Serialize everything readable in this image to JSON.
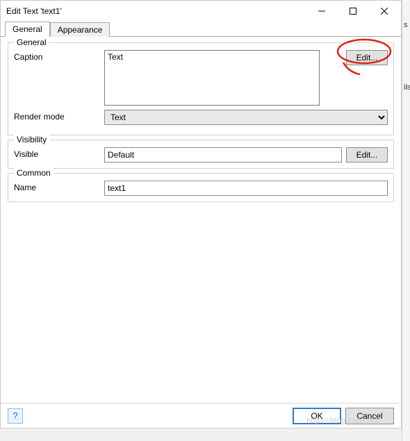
{
  "window": {
    "title": "Edit Text 'text1'"
  },
  "tabs": {
    "general": "General",
    "appearance": "Appearance"
  },
  "group_general": {
    "legend": "General",
    "caption_label": "Caption",
    "caption_value": "Text",
    "caption_edit_label": "Edit...",
    "rendermode_label": "Render mode",
    "rendermode_value": "Text"
  },
  "group_visibility": {
    "legend": "Visibility",
    "visible_label": "Visible",
    "visible_value": "Default",
    "visible_edit_label": "Edit..."
  },
  "group_common": {
    "legend": "Common",
    "name_label": "Name",
    "name_value": "text1"
  },
  "footer": {
    "help_icon": "?",
    "ok_label": "OK",
    "cancel_label": "Cancel"
  },
  "watermark": "https://blog.csdn.net/",
  "right_stub1": "s",
  "right_stub2": "ils"
}
